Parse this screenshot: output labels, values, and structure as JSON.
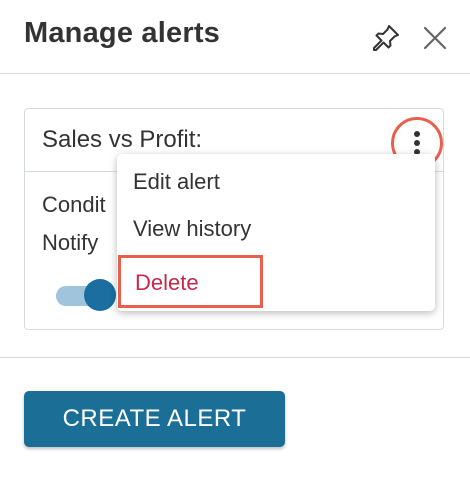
{
  "header": {
    "title": "Manage alerts",
    "pin_icon": "pin-icon",
    "close_icon": "close-icon"
  },
  "alert_card": {
    "title": "Sales vs Profit:",
    "line1": "Condit",
    "line2": "Notify",
    "menu_icon": "more-vertical-icon",
    "toggle_on": true
  },
  "menu": {
    "items": [
      {
        "label": "Edit alert"
      },
      {
        "label": "View history"
      },
      {
        "label": "Delete"
      }
    ]
  },
  "footer": {
    "create_label": "CREATE ALERT"
  },
  "colors": {
    "primary": "#1b6f97",
    "danger": "#c7294a",
    "highlight": "#e8604c",
    "toggle_knob": "#1a6ea0",
    "toggle_track": "#9fc4dc",
    "text": "#333333",
    "border": "#d5dbdb"
  }
}
